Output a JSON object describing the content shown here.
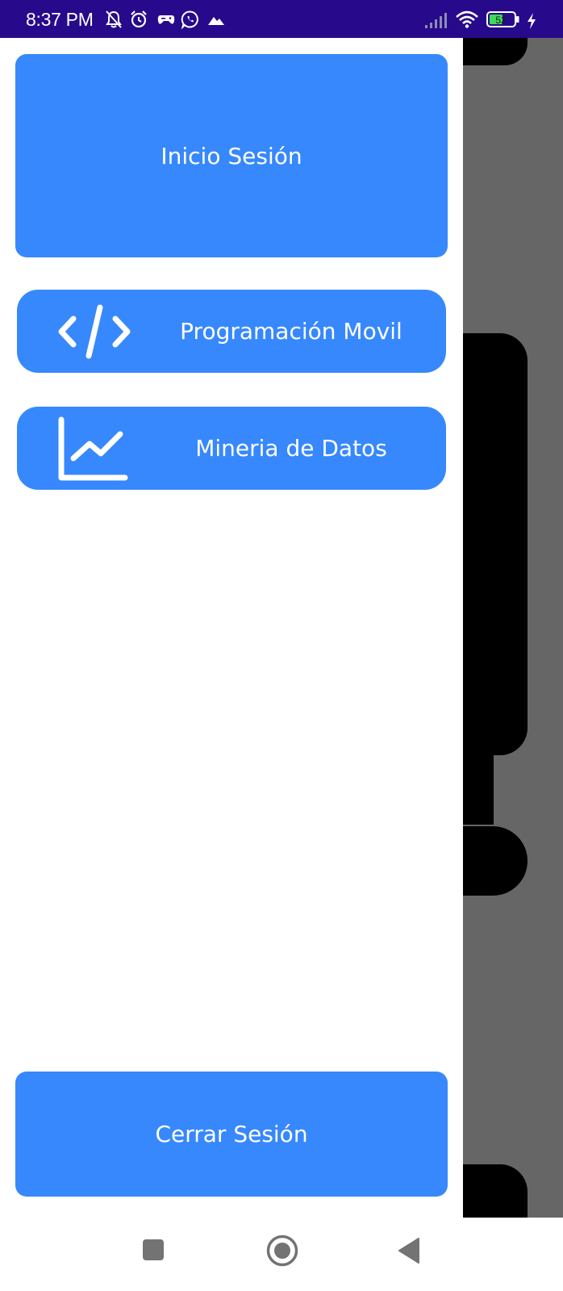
{
  "status_bar": {
    "time": "8:37 PM",
    "battery_level": "52",
    "icons": [
      "mute-icon",
      "alarm-icon",
      "game-icon",
      "whatsapp-icon",
      "cloud-icon",
      "signal-icon",
      "wifi-icon",
      "battery-icon",
      "charging-icon"
    ]
  },
  "drawer": {
    "header_label": "Inicio Sesión",
    "items": [
      {
        "label": "Programación Movil",
        "icon": "code-icon"
      },
      {
        "label": "Mineria de Datos",
        "icon": "chart-line-icon"
      }
    ],
    "logout_label": "Cerrar Sesión"
  },
  "nav_bar": {
    "buttons": [
      "recents-button",
      "home-button",
      "back-button"
    ]
  },
  "colors": {
    "status_bar": "#27098c",
    "accent": "#3788fc",
    "scrim": "#666666",
    "text_on_accent": "#ffffff"
  }
}
